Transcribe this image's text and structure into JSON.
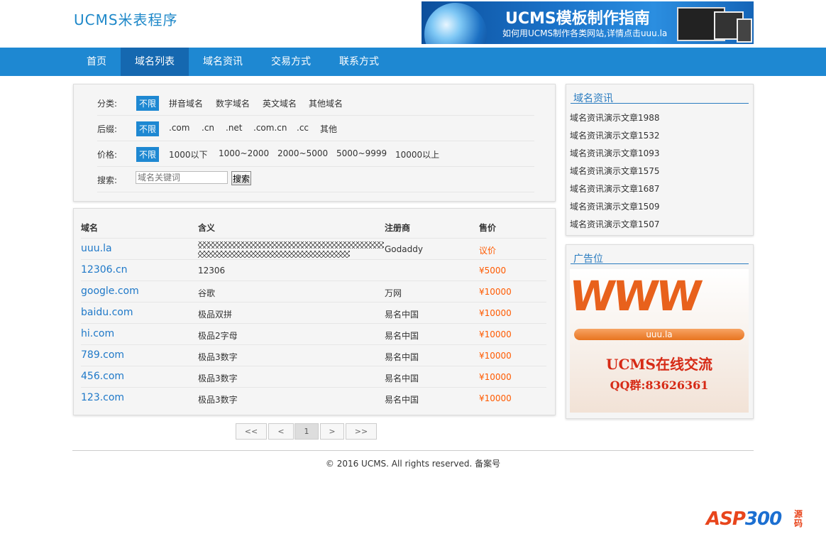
{
  "header": {
    "logo": "UCMS米表程序",
    "banner_title": "UCMS模板制作指南",
    "banner_subtitle": "如何用UCMS制作各类网站,详情点击uuu.la"
  },
  "nav": [
    "首页",
    "域名列表",
    "域名资讯",
    "交易方式",
    "联系方式"
  ],
  "nav_active": "域名列表",
  "filter": {
    "category": {
      "label": "分类:",
      "options": [
        "不限",
        "拼音域名",
        "数字域名",
        "英文域名",
        "其他域名"
      ]
    },
    "suffix": {
      "label": "后缀:",
      "options": [
        "不限",
        ".com",
        ".cn",
        ".net",
        ".com.cn",
        ".cc",
        "其他"
      ]
    },
    "price": {
      "label": "价格:",
      "options": [
        "不限",
        "1000以下",
        "1000~2000",
        "2000~5000",
        "5000~9999",
        "10000以上"
      ]
    },
    "search": {
      "label": "搜索:",
      "placeholder": "域名关键词",
      "button": "搜索"
    }
  },
  "table": {
    "headers": [
      "域名",
      "含义",
      "注册商",
      "售价"
    ],
    "rows": [
      {
        "domain": "uuu.la",
        "meaning": "",
        "registrar": "Godaddy",
        "price": "议价"
      },
      {
        "domain": "12306.cn",
        "meaning": "12306",
        "registrar": "",
        "price": "¥5000"
      },
      {
        "domain": "google.com",
        "meaning": "谷歌",
        "registrar": "万网",
        "price": "¥10000"
      },
      {
        "domain": "baidu.com",
        "meaning": "极品双拼",
        "registrar": "易名中国",
        "price": "¥10000"
      },
      {
        "domain": "hi.com",
        "meaning": "极品2字母",
        "registrar": "易名中国",
        "price": "¥10000"
      },
      {
        "domain": "789.com",
        "meaning": "极品3数字",
        "registrar": "易名中国",
        "price": "¥10000"
      },
      {
        "domain": "456.com",
        "meaning": "极品3数字",
        "registrar": "易名中国",
        "price": "¥10000"
      },
      {
        "domain": "123.com",
        "meaning": "极品3数字",
        "registrar": "易名中国",
        "price": "¥10000"
      }
    ]
  },
  "pagination": [
    "<<",
    "<",
    "1",
    ">",
    ">>"
  ],
  "pagination_current": "1",
  "sidebar": {
    "news_title": "域名资讯",
    "news": [
      "域名资讯演示文章1988",
      "域名资讯演示文章1532",
      "域名资讯演示文章1093",
      "域名资讯演示文章1575",
      "域名资讯演示文章1687",
      "域名资讯演示文章1509",
      "域名资讯演示文章1507"
    ],
    "ad_title": "广告位",
    "ad": {
      "www": "WWW",
      "bar": "uuu.la",
      "line1": "UCMS在线交流",
      "line2": "QQ群:83626361"
    }
  },
  "footer": "© 2016 UCMS. All rights reserved. 备案号",
  "watermark": {
    "brand": "ASP",
    "number": "300",
    "suffix": "源码"
  },
  "colors": {
    "primary": "#1e88d2",
    "nav_active": "#1568b0",
    "price": "#ff5a00",
    "link": "#1e78c8"
  }
}
